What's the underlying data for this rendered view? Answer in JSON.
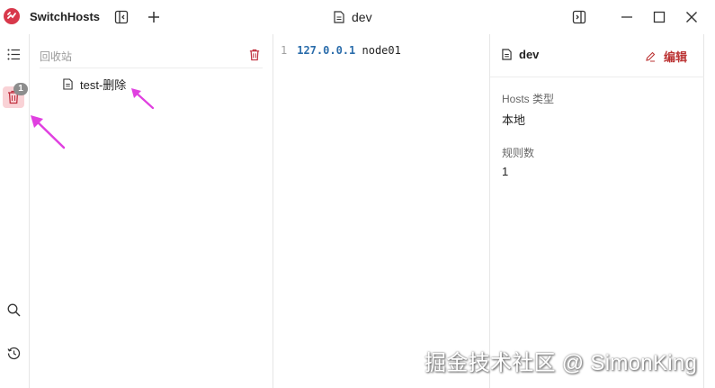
{
  "app": {
    "title": "SwitchHosts"
  },
  "titlebar": {
    "document_title": "dev"
  },
  "rail": {
    "trash_count": "1"
  },
  "trash_panel": {
    "title": "回收站",
    "items": [
      {
        "label": "test-删除"
      }
    ]
  },
  "editor": {
    "lines": [
      {
        "number": "1",
        "ip": "127.0.0.1",
        "host": "node01"
      }
    ]
  },
  "info_panel": {
    "name": "dev",
    "edit_label": "编辑",
    "hosts_type_label": "Hosts 类型",
    "hosts_type_value": "本地",
    "rules_label": "规则数",
    "rules_value": "1"
  },
  "watermark": "掘金技术社区 @ SimonKing",
  "colors": {
    "brand": "#d8384b",
    "accent_arrow": "#e040e0",
    "ip": "#2b6dab",
    "edit": "#b33333"
  },
  "icons": [
    "app-logo-icon",
    "toggle-sidebar-icon",
    "plus-icon",
    "document-icon",
    "panel-right-icon",
    "minimize-icon",
    "maximize-icon",
    "close-icon",
    "list-icon",
    "trash-icon",
    "search-icon",
    "history-icon",
    "edit-icon"
  ]
}
